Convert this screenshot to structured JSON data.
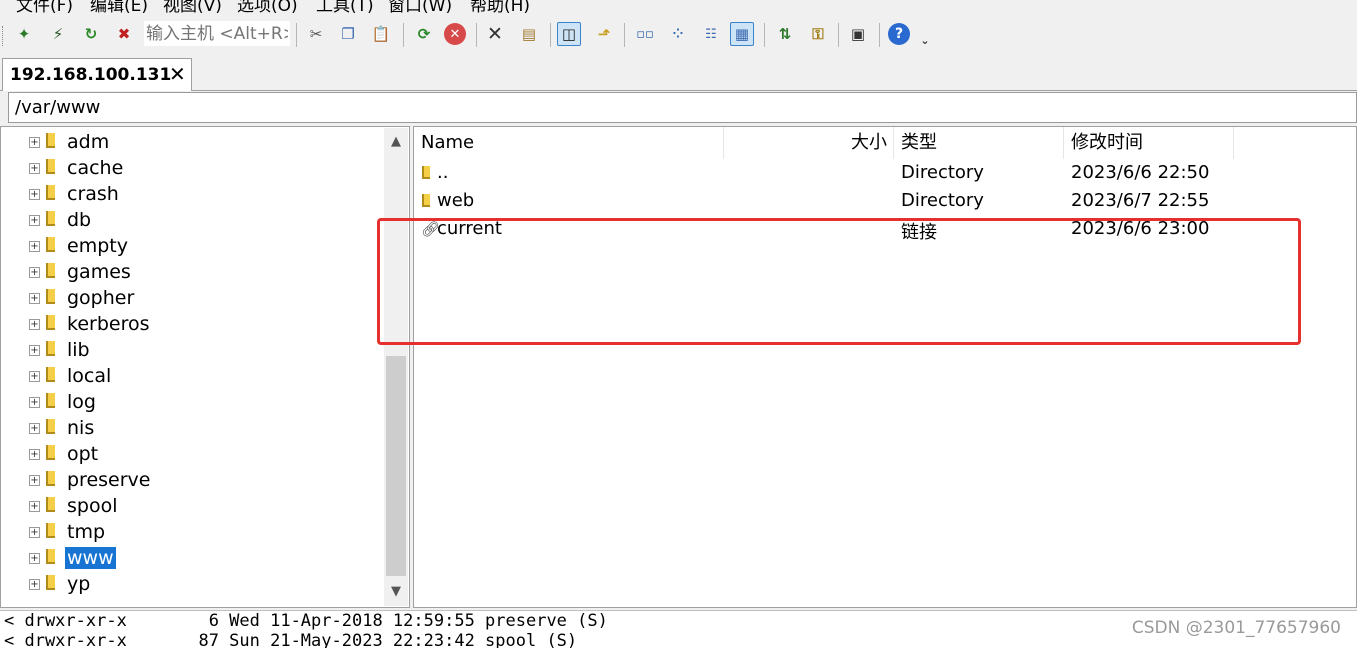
{
  "menu": {
    "items": [
      "文件(F)",
      "编辑(E)",
      "视图(V)",
      "选项(O)",
      "工具(T)",
      "窗口(W)",
      "帮助(H)"
    ]
  },
  "toolbar": {
    "host_placeholder": "输入主机 <Alt+R>",
    "buttons": [
      "new-session-icon",
      "quick-connect-icon",
      "reconnect-icon",
      "disconnect-icon",
      "cut-icon",
      "copy-icon",
      "paste-icon",
      "refresh-icon",
      "stop-icon",
      "delete-icon",
      "properties-icon",
      "view-tree-icon",
      "up-folder-icon",
      "large-icons-icon",
      "small-icons-icon",
      "list-view-icon",
      "details-view-icon",
      "transfer-queue-icon",
      "key-icon",
      "options-icon",
      "help-icon"
    ]
  },
  "tab": {
    "label": "192.168.100.131",
    "close": "✕"
  },
  "path": {
    "value": "/var/www"
  },
  "tree": {
    "items": [
      {
        "label": "adm"
      },
      {
        "label": "cache"
      },
      {
        "label": "crash"
      },
      {
        "label": "db"
      },
      {
        "label": "empty"
      },
      {
        "label": "games"
      },
      {
        "label": "gopher"
      },
      {
        "label": "kerberos"
      },
      {
        "label": "lib"
      },
      {
        "label": "local"
      },
      {
        "label": "log"
      },
      {
        "label": "nis"
      },
      {
        "label": "opt"
      },
      {
        "label": "preserve"
      },
      {
        "label": "spool"
      },
      {
        "label": "tmp"
      },
      {
        "label": "www",
        "selected": true
      },
      {
        "label": "yp"
      }
    ]
  },
  "list": {
    "columns": {
      "name": "Name",
      "size": "大小",
      "type": "类型",
      "modified": "修改时间"
    },
    "rows": [
      {
        "name": "..",
        "size": "",
        "type": "Directory",
        "modified": "2023/6/6 22:50",
        "icon": "folder"
      },
      {
        "name": "web",
        "size": "",
        "type": "Directory",
        "modified": "2023/6/7 22:55",
        "icon": "folder"
      },
      {
        "name": "current",
        "size": "",
        "type": "链接",
        "modified": "2023/6/6 23:00",
        "icon": "link"
      }
    ]
  },
  "console": {
    "lines": [
      "< drwxr-xr-x        6 Wed 11-Apr-2018 12:59:55 preserve (S)",
      "< drwxr-xr-x       87 Sun 21-May-2023 22:23:42 spool (S)"
    ]
  },
  "watermark": "CSDN @2301_77657960",
  "colors": {
    "selection": "#1874d2",
    "highlight_box": "#e53030",
    "folder": "#f6cf48"
  }
}
